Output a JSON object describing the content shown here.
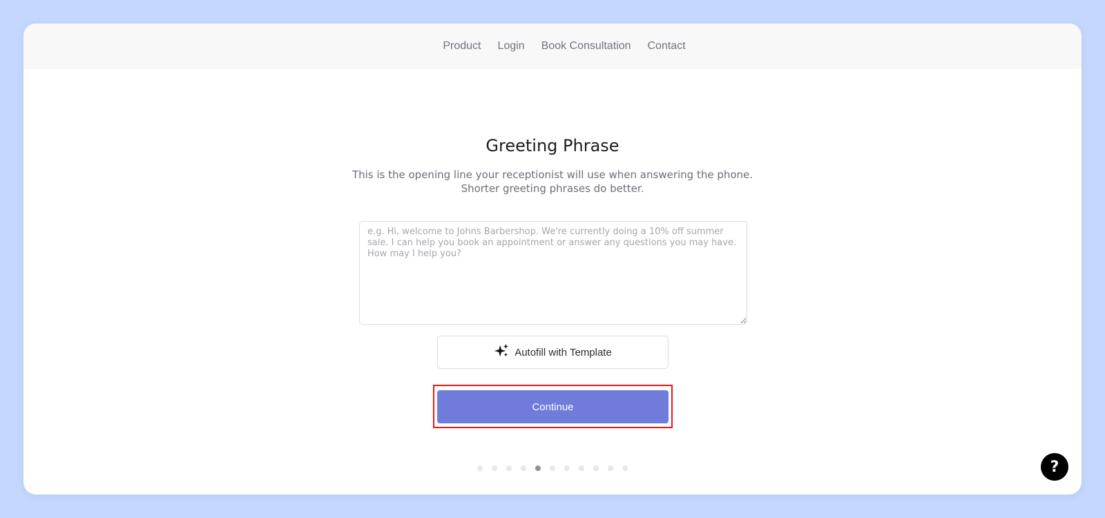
{
  "nav": {
    "items": [
      {
        "label": "Product"
      },
      {
        "label": "Login"
      },
      {
        "label": "Book Consultation"
      },
      {
        "label": "Contact"
      }
    ]
  },
  "main": {
    "title": "Greeting Phrase",
    "subtitle_line1": "This is the opening line your receptionist will use when answering the phone.",
    "subtitle_line2": "Shorter greeting phrases do better.",
    "greeting_input": {
      "value": "",
      "placeholder": "e.g. Hi, welcome to Johns Barbershop. We're currently doing a 10% off summer sale. I can help you book an appointment or answer any questions you may have. How may I help you?"
    },
    "autofill_button": {
      "label": "Autofill with Template",
      "icon": "sparkles-icon"
    },
    "continue_button": {
      "label": "Continue"
    }
  },
  "progress": {
    "total_steps": 11,
    "current_step": 5
  },
  "help_button": {
    "label": "?"
  },
  "colors": {
    "page_background": "#c4d8fd",
    "accent": "#6f7cda",
    "highlight": "#ef1414"
  }
}
